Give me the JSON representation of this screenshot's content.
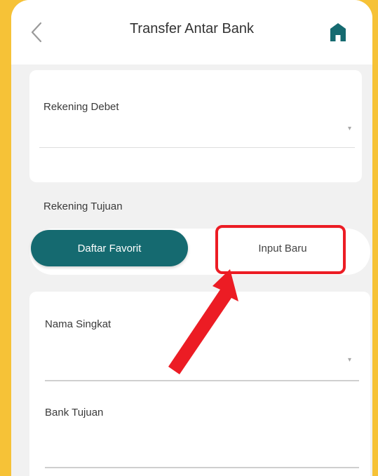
{
  "header": {
    "title": "Transfer Antar Bank",
    "back_icon": "chevron-left-icon",
    "home_icon": "home-icon"
  },
  "debit": {
    "label": "Rekening Debet",
    "value": ""
  },
  "destination": {
    "label": "Rekening Tujuan",
    "tabs": {
      "favorites": "Daftar Favorit",
      "new_input": "Input Baru"
    },
    "active_tab": "favorites"
  },
  "form": {
    "short_name_label": "Nama Singkat",
    "short_name_value": "",
    "bank_label": "Bank Tujuan",
    "bank_value": ""
  },
  "colors": {
    "background": "#f6c237",
    "accent": "#156a70",
    "highlight": "#ec1c24"
  }
}
